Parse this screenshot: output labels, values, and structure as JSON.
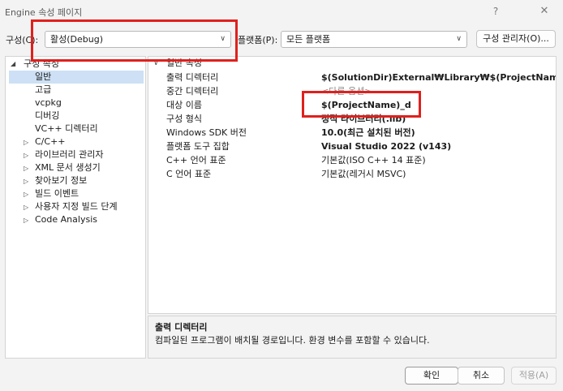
{
  "window": {
    "title": "Engine 속성 페이지",
    "help_glyph": "?",
    "close_glyph": "✕"
  },
  "toolbar": {
    "configuration_label": "구성(C):",
    "configuration_value": "활성(Debug)",
    "platform_label": "플랫폼(P):",
    "platform_value": "모든 플랫폼",
    "config_manager_label": "구성 관리자(O)..."
  },
  "tree": {
    "items": [
      {
        "label": "구성 속성",
        "expanded": true
      },
      {
        "label": "일반",
        "selected": true
      },
      {
        "label": "고급"
      },
      {
        "label": "vcpkg"
      },
      {
        "label": "디버깅"
      },
      {
        "label": "VC++ 디렉터리"
      },
      {
        "label": "C/C++"
      },
      {
        "label": "라이브러리 관리자"
      },
      {
        "label": "XML 문서 생성기"
      },
      {
        "label": "찾아보기 정보"
      },
      {
        "label": "빌드 이벤트"
      },
      {
        "label": "사용자 지정 빌드 단계"
      },
      {
        "label": "Code Analysis"
      }
    ]
  },
  "grid": {
    "category": "일반 속성",
    "rows": [
      {
        "name": "출력 디렉터리",
        "value": "$(SolutionDir)External₩Library₩$(ProjectName)₩",
        "bold": true
      },
      {
        "name": "중간 디렉터리",
        "value": "<다른 옵션>",
        "gray": true
      },
      {
        "name": "대상 이름",
        "value": "$(ProjectName)_d",
        "bold": true
      },
      {
        "name": "구성 형식",
        "value": "정적 라이브러리(.lib)",
        "bold": true
      },
      {
        "name": "Windows SDK 버전",
        "value": "10.0(최근 설치된 버전)",
        "bold": true
      },
      {
        "name": "플랫폼 도구 집합",
        "value": "Visual Studio 2022 (v143)",
        "bold": true
      },
      {
        "name": "C++ 언어 표준",
        "value": "기본값(ISO C++ 14 표준)"
      },
      {
        "name": "C 언어 표준",
        "value": "기본값(레거시 MSVC)"
      }
    ]
  },
  "description": {
    "title": "출력 디렉터리",
    "text": "컴파일된 프로그램이 배치될 경로입니다. 환경 변수를 포함할 수 있습니다."
  },
  "buttons": {
    "ok": "확인",
    "cancel": "취소",
    "apply": "적용(A)"
  },
  "colors": {
    "highlight": "#e0201c",
    "selection": "#cde0f5"
  }
}
